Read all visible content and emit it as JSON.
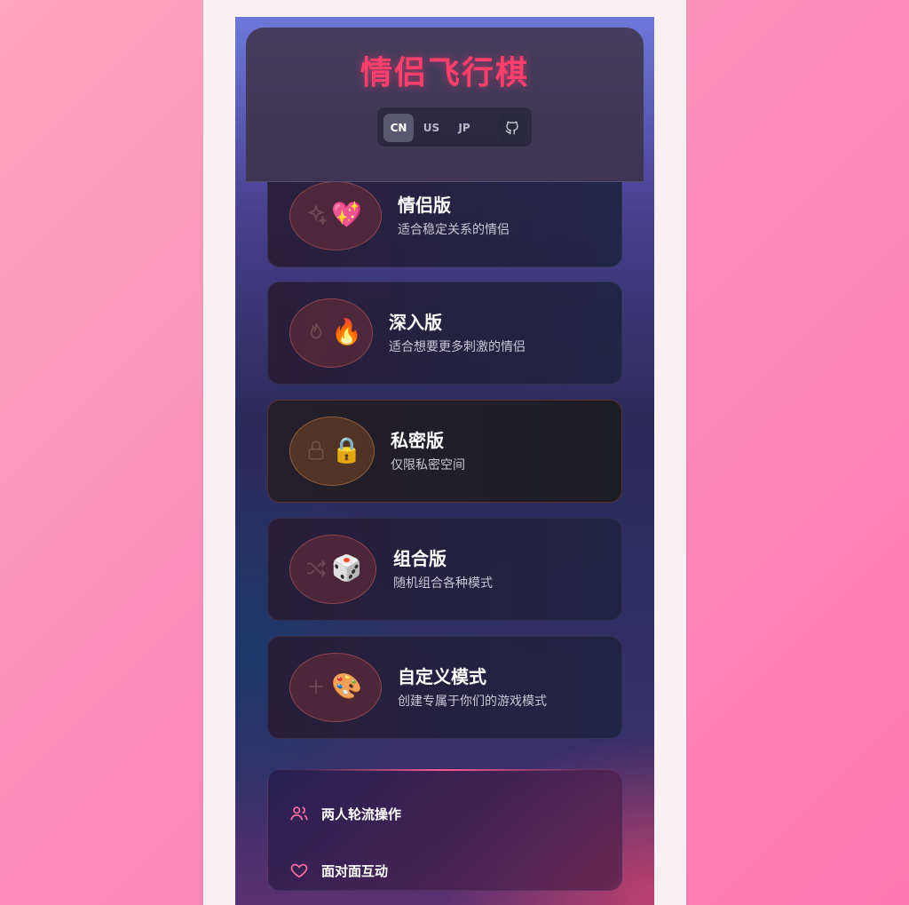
{
  "app": {
    "title": "情侣飞行棋"
  },
  "languages": [
    {
      "code": "CN",
      "active": true
    },
    {
      "code": "US",
      "active": false
    },
    {
      "code": "JP",
      "active": false
    }
  ],
  "github": {
    "icon": "github-icon"
  },
  "modes": [
    {
      "title": "情侣版",
      "desc": "适合稳定关系的情侣",
      "emoji": "💖",
      "icon": "sparkles-icon"
    },
    {
      "title": "深入版",
      "desc": "适合想要更多刺激的情侣",
      "emoji": "🔥",
      "icon": "flame-icon"
    },
    {
      "title": "私密版",
      "desc": "仅限私密空间",
      "emoji": "🔒",
      "icon": "lock-icon",
      "selected": true
    },
    {
      "title": "组合版",
      "desc": "随机组合各种模式",
      "emoji": "🎲",
      "icon": "shuffle-icon"
    },
    {
      "title": "自定义模式",
      "desc": "创建专属于你们的游戏模式",
      "emoji": "🎨",
      "icon": "plus-icon"
    }
  ],
  "features": [
    {
      "label": "两人轮流操作",
      "icon": "users-icon"
    },
    {
      "label": "面对面互动",
      "icon": "heart-icon"
    }
  ],
  "colors": {
    "accent": "#ff3f6c",
    "icon_pink": "#ff6fa0"
  }
}
